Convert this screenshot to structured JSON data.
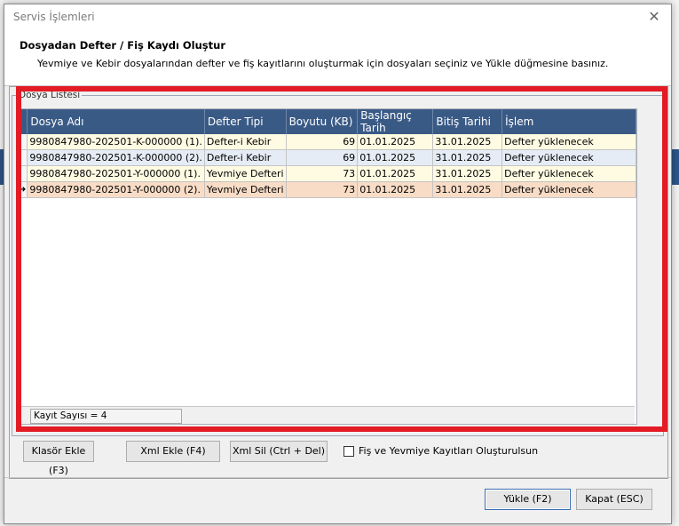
{
  "dialog": {
    "title": "Servis İşlemleri",
    "header_title": "Dosyadan Defter / Fiş Kaydı Oluştur",
    "header_subtitle": "Yevmiye ve Kebir dosyalarından defter ve fiş kayıtlarını oluşturmak için dosyaları seçiniz ve Yükle düğmesine basınız."
  },
  "group": {
    "legend": "Dosya Listesi"
  },
  "grid": {
    "columns": [
      "Dosya Adı",
      "Defter Tipi",
      "Boyutu (KB)",
      "Başlangıç Tarih",
      "Bitiş Tarihi",
      "İşlem"
    ],
    "rows": [
      {
        "indicator": "",
        "file": "9980847980-202501-K-000000 (1).",
        "type": "Defter-i Kebir",
        "size": "69",
        "start": "01.01.2025",
        "end": "31.01.2025",
        "action": "Defter yüklenecek",
        "bg": "#fffbe3"
      },
      {
        "indicator": "",
        "file": "9980847980-202501-K-000000 (2).",
        "type": "Defter-i Kebir",
        "size": "69",
        "start": "01.01.2025",
        "end": "31.01.2025",
        "action": "Defter yüklenecek",
        "bg": "#e5ecf5"
      },
      {
        "indicator": "",
        "file": "9980847980-202501-Y-000000 (1).",
        "type": "Yevmiye Defteri",
        "size": "73",
        "start": "01.01.2025",
        "end": "31.01.2025",
        "action": "Defter yüklenecek",
        "bg": "#fffbe3"
      },
      {
        "indicator": "➜",
        "file": "9980847980-202501-Y-000000 (2).",
        "type": "Yevmiye Defteri",
        "size": "73",
        "start": "01.01.2025",
        "end": "31.01.2025",
        "action": "Defter yüklenecek",
        "bg": "#f8dcc6"
      }
    ],
    "record_count": "Kayıt Sayısı = 4"
  },
  "buttons": {
    "add_folder": "Klasör Ekle (F3)",
    "add_xml": "Xml Ekle (F4)",
    "delete_xml": "Xml Sil (Ctrl + Del)",
    "load": "Yükle (F2)",
    "close": "Kapat (ESC)"
  },
  "checkbox": {
    "label": "Fiş ve Yevmiye Kayıtları Oluşturulsun",
    "checked": false
  },
  "colors": {
    "highlight": "#e21b24",
    "grid_header": "#3a5a86"
  }
}
